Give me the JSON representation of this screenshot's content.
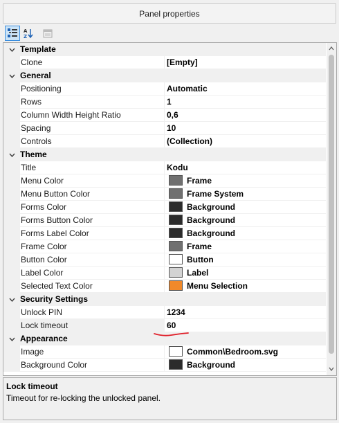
{
  "window": {
    "title": "Panel properties"
  },
  "toolbar": {
    "categorized_icon": "categorized-icon",
    "alphabetical_icon": "sort-az-icon",
    "property_pages_icon": "property-pages-icon"
  },
  "grid": {
    "categories": [
      {
        "label": "Template",
        "properties": [
          {
            "name": "Clone",
            "value": "[Empty]"
          }
        ]
      },
      {
        "label": "General",
        "properties": [
          {
            "name": "Positioning",
            "value": "Automatic"
          },
          {
            "name": "Rows",
            "value": "1"
          },
          {
            "name": "Column Width Height Ratio",
            "value": "0,6"
          },
          {
            "name": "Spacing",
            "value": "10"
          },
          {
            "name": "Controls",
            "value": "(Collection)"
          }
        ]
      },
      {
        "label": "Theme",
        "properties": [
          {
            "name": "Title",
            "value": "Kodu"
          },
          {
            "name": "Menu Color",
            "value": "Frame",
            "swatch": "#707070"
          },
          {
            "name": "Menu Button Color",
            "value": "Frame System",
            "swatch": "#707070"
          },
          {
            "name": "Forms Color",
            "value": "Background",
            "swatch": "#2b2b2b"
          },
          {
            "name": "Forms Button Color",
            "value": "Background",
            "swatch": "#2b2b2b"
          },
          {
            "name": "Forms Label Color",
            "value": "Background",
            "swatch": "#2b2b2b"
          },
          {
            "name": "Frame Color",
            "value": "Frame",
            "swatch": "#707070"
          },
          {
            "name": "Button Color",
            "value": "Button",
            "swatch": "#ffffff"
          },
          {
            "name": "Label Color",
            "value": "Label",
            "swatch": "#d3d3d3"
          },
          {
            "name": "Selected Text Color",
            "value": "Menu Selection",
            "swatch": "#f0892a"
          }
        ]
      },
      {
        "label": "Security Settings",
        "properties": [
          {
            "name": "Unlock PIN",
            "value": "1234"
          },
          {
            "name": "Lock timeout",
            "value": "60"
          }
        ]
      },
      {
        "label": "Appearance",
        "properties": [
          {
            "name": "Image",
            "value": "Common\\Bedroom.svg",
            "swatch": "#ffffff"
          },
          {
            "name": "Background Color",
            "value": "Background",
            "swatch": "#2b2b2b"
          }
        ]
      }
    ]
  },
  "description": {
    "title": "Lock timeout",
    "text": "Timeout for re-locking the unlocked panel."
  },
  "colors": {
    "annotation": "#e0202a",
    "selection": "#cce4f7"
  }
}
